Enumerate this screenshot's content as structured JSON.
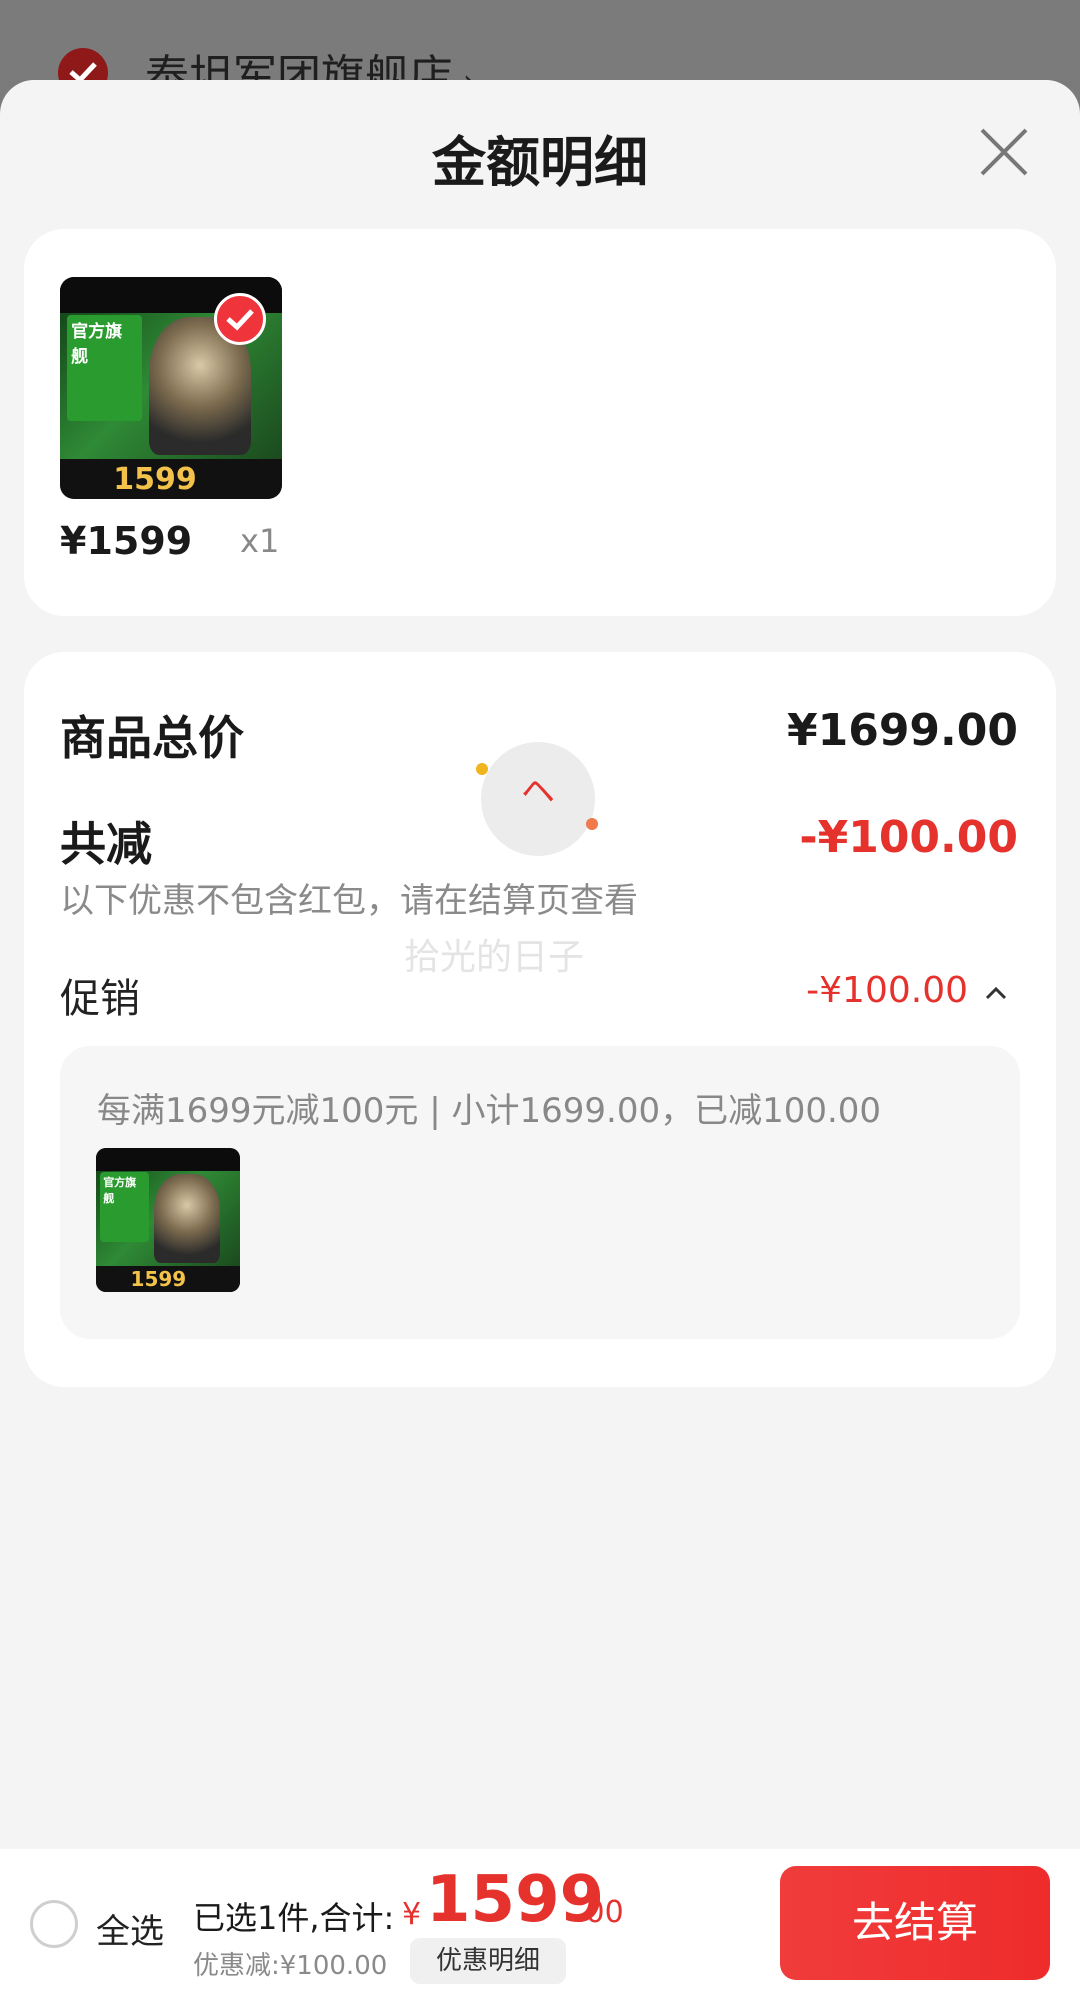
{
  "store": {
    "name": "泰坦军团旗舰店",
    "chevron": "›"
  },
  "sheet": {
    "title": "金额明细"
  },
  "product": {
    "price": "¥1599",
    "qty": "x1",
    "thumb_price": "1599",
    "thumb_badge": "官方旗舰"
  },
  "summary": {
    "total_label": "商品总价",
    "total_value": "¥1699.00",
    "reduce_label": "共减",
    "reduce_value": "-¥100.00",
    "reduce_note": "以下优惠不包含红包，请在结算页查看",
    "promo_label": "促销",
    "promo_value": "-¥100.00",
    "promo_rule": "每满1699元减100元 | 小计1699.00，已减100.00"
  },
  "overlay": {
    "loading_glyph": "ヘ",
    "watermark": "拾光的日子"
  },
  "bottom": {
    "select_all": "全选",
    "selected_text": "已选1件,合计:",
    "currency": "¥",
    "total_integer": "1599",
    "total_decimal": ".00",
    "discount": "优惠减:¥100.00",
    "detail_button": "优惠明细",
    "checkout_button": "去结算"
  },
  "colors": {
    "accent": "#e5322d",
    "button": "#ef2b2b",
    "sheet_bg": "#f4f4f4"
  },
  "icons": [
    "check-circle-icon",
    "close-icon",
    "chevron-up-icon",
    "radio-icon"
  ]
}
